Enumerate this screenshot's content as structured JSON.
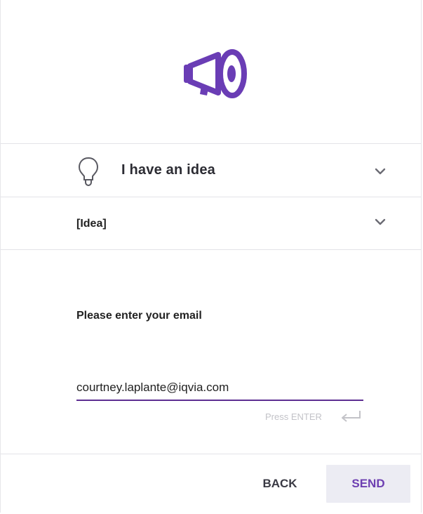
{
  "colors": {
    "accent": "#6a3db5",
    "input_underline": "#5d2e91",
    "send_background": "#ececf3",
    "muted_text": "#c3c3c8"
  },
  "header": {
    "icon": "megaphone-icon"
  },
  "category": {
    "icon": "lightbulb-icon",
    "label": "I have an idea",
    "toggle_icon": "chevron-down-icon"
  },
  "subcategory": {
    "label": "[Idea]",
    "toggle_icon": "chevron-down-icon"
  },
  "email": {
    "title": "Please enter your email",
    "value": "courtney.laplante@iqvia.com",
    "hint": "Press ENTER",
    "hint_icon": "enter-key-icon"
  },
  "footer": {
    "back_label": "BACK",
    "send_label": "SEND"
  }
}
